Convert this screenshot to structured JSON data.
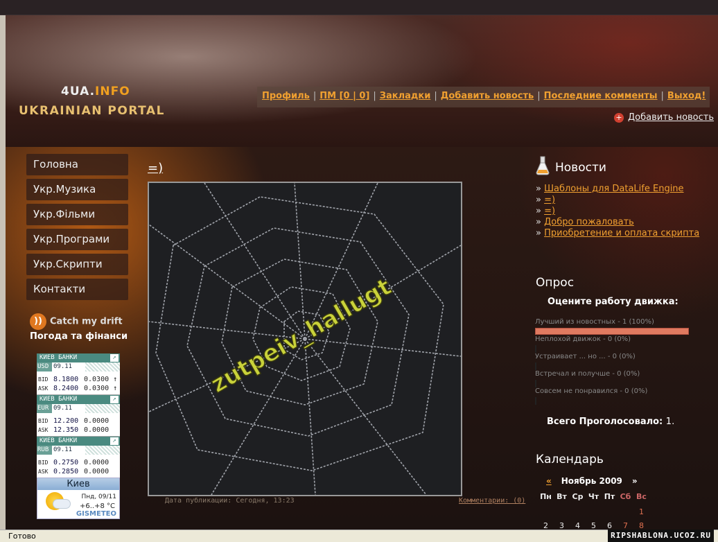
{
  "logo": {
    "part1": "4UA.",
    "part2": "INFO",
    "subtitle": "UKRAINIAN PORTAL"
  },
  "usernav": [
    {
      "label": "Профиль"
    },
    {
      "label": "ПМ [0 | 0]"
    },
    {
      "label": "Закладки"
    },
    {
      "label": "Добавить новость"
    },
    {
      "label": "Последние комменты"
    },
    {
      "label": "Выход!"
    }
  ],
  "add_news_link": "Добавить новость",
  "menu": [
    "Головна",
    "Укр.Музика",
    "Укр.Фільми",
    "Укр.Програми",
    "Укр.Скрипти",
    "Контакти"
  ],
  "rss_label": "Catch my drift",
  "weather_title": "Погода та фінанси",
  "rates": [
    {
      "head": "КИЕВ БАНКИ",
      "currency": "USD",
      "date": "09.11",
      "bid": "8.1800",
      "bid_change": "0.0300",
      "bid_arrow": "↑",
      "ask": "8.2400",
      "ask_change": "0.0300",
      "ask_arrow": "↑"
    },
    {
      "head": "КИЕВ БАНКИ",
      "currency": "EUR",
      "date": "09.11",
      "bid": "12.200",
      "bid_change": "0.0000",
      "bid_arrow": "",
      "ask": "12.350",
      "ask_change": "0.0000",
      "ask_arrow": ""
    },
    {
      "head": "КИЕВ БАНКИ",
      "currency": "RUB",
      "date": "09.11",
      "bid": "0.2750",
      "bid_change": "0.0000",
      "bid_arrow": "",
      "ask": "0.2850",
      "ask_change": "0.0000",
      "ask_arrow": ""
    }
  ],
  "rate_labels": {
    "bid": "BID",
    "ask": "ASK"
  },
  "gismeteo": {
    "city": "Киев",
    "date": "Пнд, 09/11",
    "temp": "+6..+8 °C",
    "brand": "GISMETEO"
  },
  "article": {
    "title": "=)",
    "image_text": "zutpeiv_hallugt",
    "meta": "Дата публикации: Сегодня, 13:23",
    "comments": "Комментарии: (0)"
  },
  "news": {
    "heading": "Новости",
    "items": [
      "Шаблоны для DataLife Engine",
      "=)",
      "=)",
      "Добро пожаловать",
      "Приобретение и оплата скрипта"
    ]
  },
  "poll": {
    "heading": "Опрос",
    "question": "Оцените работу движка:",
    "answers": [
      {
        "label": "Лучший из новостных - 1 (100%)",
        "percent": 100
      },
      {
        "label": "Неплохой движок - 0 (0%)",
        "percent": 0
      },
      {
        "label": "Устраивает ... но ... - 0 (0%)",
        "percent": 0
      },
      {
        "label": "Встречал и получше - 0 (0%)",
        "percent": 0
      },
      {
        "label": "Совсем не понравился - 0 (0%)",
        "percent": 0
      }
    ],
    "total_label": "Всего Проголосовало:",
    "total_value": "1."
  },
  "calendar": {
    "heading": "Календарь",
    "prev": "«",
    "month": "Ноябрь 2009",
    "next": "»",
    "weekdays": [
      "Пн",
      "Вт",
      "Ср",
      "Чт",
      "Пт",
      "Сб",
      "Вс"
    ],
    "rows": [
      [
        "",
        "",
        "",
        "",
        "",
        "",
        "1"
      ],
      [
        "2",
        "3",
        "4",
        "5",
        "6",
        "7",
        "8"
      ]
    ]
  },
  "status": "Готово",
  "watermark": "RIPSHABLONA.UCOZ.RU"
}
